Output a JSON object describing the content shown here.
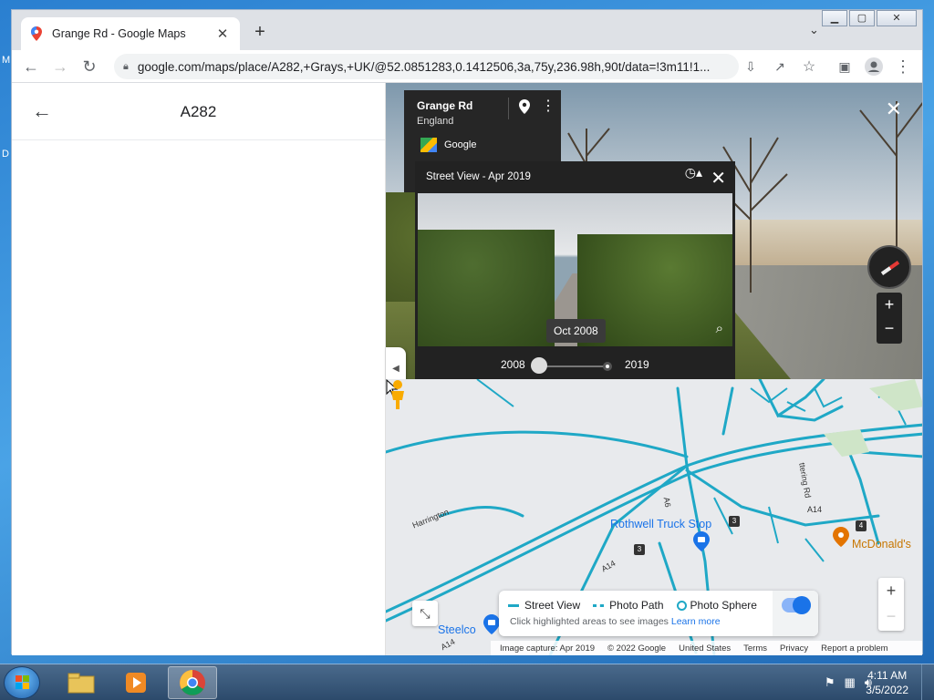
{
  "browser": {
    "tab_title": "Grange Rd - Google Maps",
    "url": "google.com/maps/place/A282,+Grays,+UK/@52.0851283,0.1412506,3a,75y,236.98h,90t/data=!3m11!1..."
  },
  "left_panel": {
    "title": "A282"
  },
  "street_view": {
    "place_name": "Grange Rd",
    "place_region": "England",
    "provider": "Google"
  },
  "time_machine": {
    "header": "Street View - Apr 2019",
    "date_tooltip": "Oct 2008",
    "year_start": "2008",
    "year_end": "2019"
  },
  "map": {
    "labels": {
      "rothwell": "Rothwell Truck Stop",
      "steelco": "Steelco",
      "mcdonalds": "McDonald's",
      "harrington": "Harrington",
      "a14_a": "A14",
      "a14_b": "A14",
      "a14_c": "A14",
      "a6": "A6",
      "ketting": "ttering Rd",
      "j3a": "3",
      "j3b": "3",
      "j4": "4"
    },
    "legend": {
      "street_view": "Street View",
      "photo_path": "Photo Path",
      "photo_sphere": "Photo Sphere",
      "hint": "Click highlighted areas to see images",
      "learn_more": "Learn more"
    },
    "attribution": {
      "capture": "Image capture: Apr 2019",
      "copyright": "© 2022 Google",
      "country": "United States",
      "terms": "Terms",
      "privacy": "Privacy",
      "report": "Report a problem"
    }
  },
  "taskbar": {
    "time": "4:11 AM",
    "date": "3/5/2022"
  },
  "desktop": {
    "edge_letters": [
      "M",
      "D"
    ]
  },
  "colors": {
    "street_view_lines": "#1fa8c6",
    "link_blue": "#1a73e8"
  }
}
